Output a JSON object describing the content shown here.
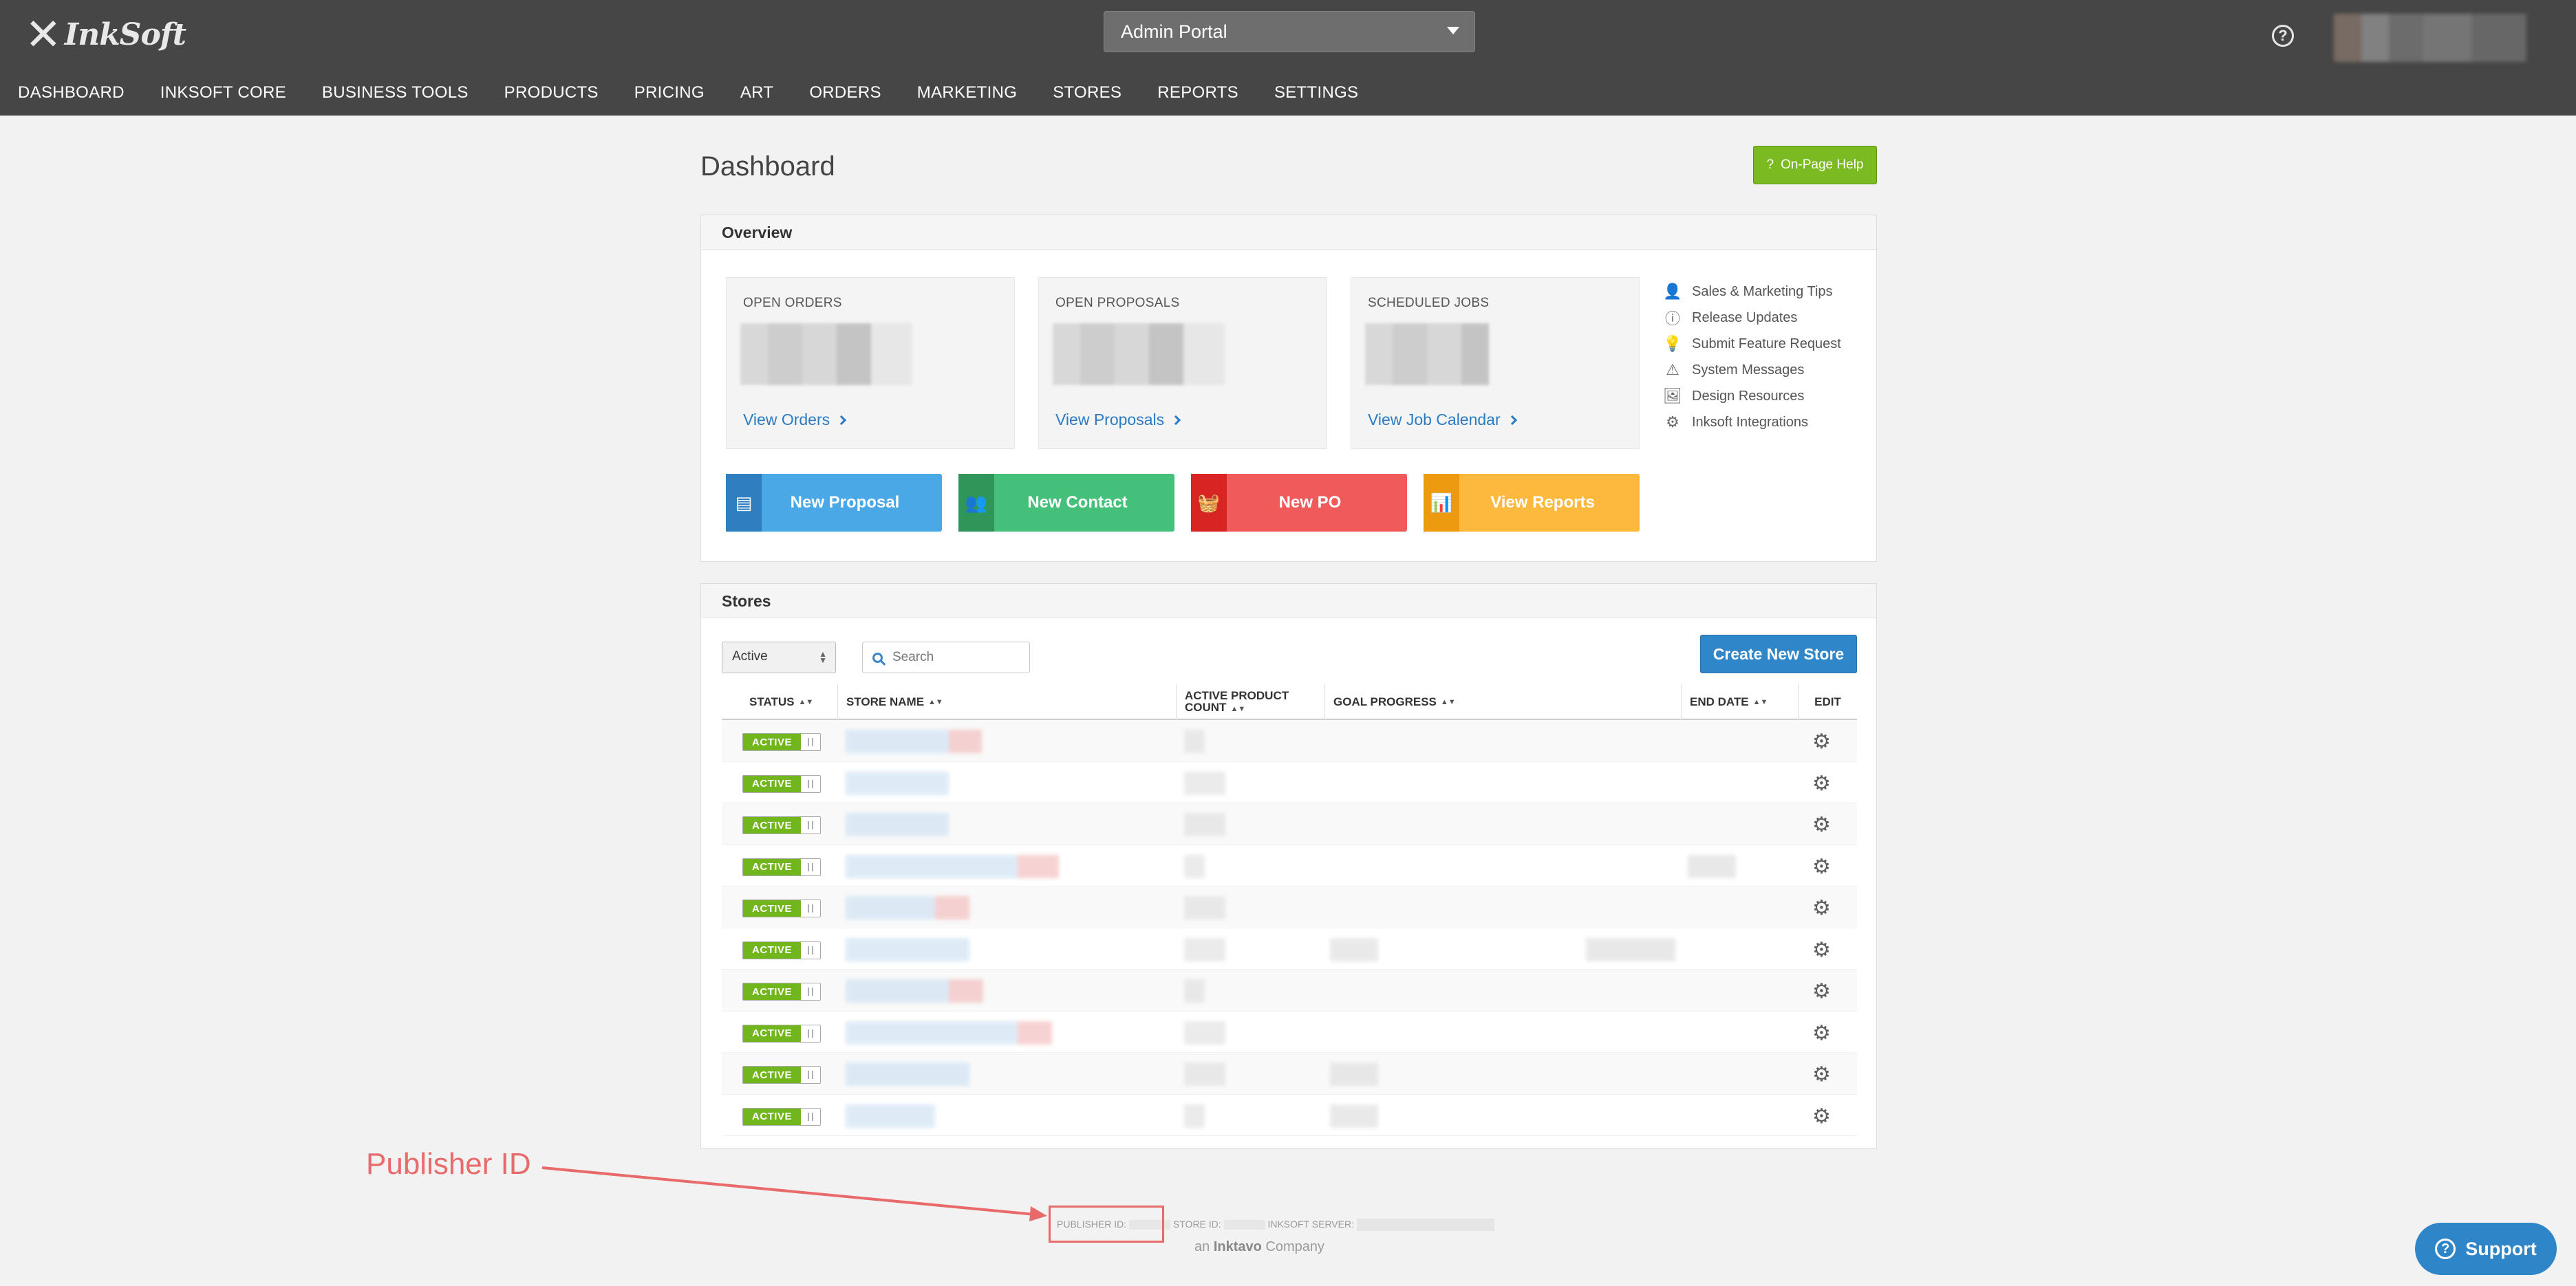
{
  "header": {
    "logo_text": "InkSoft",
    "portal_select": "Admin Portal",
    "help_icon": "question-circle-icon"
  },
  "nav": {
    "items": [
      "DASHBOARD",
      "INKSOFT CORE",
      "BUSINESS TOOLS",
      "PRODUCTS",
      "PRICING",
      "ART",
      "ORDERS",
      "MARKETING",
      "STORES",
      "REPORTS",
      "SETTINGS"
    ]
  },
  "page": {
    "title": "Dashboard",
    "help_button": "On-Page Help",
    "help_button_glyph": "?"
  },
  "overview": {
    "title": "Overview",
    "cards": [
      {
        "label": "OPEN ORDERS",
        "link": "View Orders"
      },
      {
        "label": "OPEN PROPOSALS",
        "link": "View Proposals"
      },
      {
        "label": "SCHEDULED JOBS",
        "link": "View Job Calendar"
      }
    ],
    "quick_links": [
      {
        "label": "Sales & Marketing Tips",
        "icon": "person-speaking-icon",
        "glyph": "👤"
      },
      {
        "label": "Release Updates",
        "icon": "info-circle-icon",
        "glyph": "ⓘ"
      },
      {
        "label": "Submit Feature Request",
        "icon": "lightbulb-icon",
        "glyph": "💡"
      },
      {
        "label": "System Messages",
        "icon": "warning-triangle-icon",
        "glyph": "⚠"
      },
      {
        "label": "Design Resources",
        "icon": "image-icon",
        "glyph": "🖼"
      },
      {
        "label": "Inksoft Integrations",
        "icon": "gear-icon",
        "glyph": "⚙"
      }
    ],
    "actions": [
      {
        "label": "New Proposal",
        "icon": "document-icon",
        "glyph": "▤",
        "color": "#4aa8e6",
        "icon_bg": "#2f7fc0"
      },
      {
        "label": "New Contact",
        "icon": "people-icon",
        "glyph": "👥",
        "color": "#45c07a",
        "icon_bg": "#2f9558"
      },
      {
        "label": "New PO",
        "icon": "basket-icon",
        "glyph": "🧺",
        "color": "#f15a5a",
        "icon_bg": "#d92424"
      },
      {
        "label": "View Reports",
        "icon": "bar-chart-icon",
        "glyph": "📊",
        "color": "#fdb93e",
        "icon_bg": "#ee9a10"
      }
    ]
  },
  "stores": {
    "title": "Stores",
    "filter_value": "Active",
    "search_placeholder": "Search",
    "create_button": "Create New Store",
    "columns": {
      "status": "STATUS",
      "store_name": "STORE NAME",
      "product_count_line1": "ACTIVE PRODUCT",
      "product_count_line2": "COUNT",
      "goal_progress": "GOAL PROGRESS",
      "end_date": "END DATE",
      "edit": "EDIT"
    },
    "row_status_label": "ACTIVE",
    "row_count": 10
  },
  "footer": {
    "publisher_id_label": "PUBLISHER ID:",
    "store_id_label": "STORE ID:",
    "server_label": "INKSOFT SERVER:",
    "tagline_prefix": "an",
    "tagline_brand": "Inktavo",
    "tagline_suffix": "Company"
  },
  "annotation": {
    "label": "Publisher ID",
    "color": "#e86a6a"
  },
  "support": {
    "label": "Support"
  }
}
